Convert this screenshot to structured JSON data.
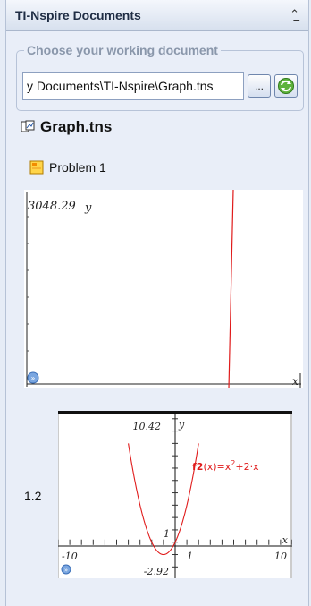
{
  "panel": {
    "title": "TI-Nspire Documents",
    "collapse_icon": "double-chevron-up-icon"
  },
  "chooser": {
    "legend": "Choose your working document",
    "path_value": "y Documents\\TI-Nspire\\Graph.tns",
    "browse_label": "...",
    "refresh_icon": "refresh-icon"
  },
  "document": {
    "name": "Graph.tns",
    "icon": "document-icon"
  },
  "problem": {
    "label": "Problem 1",
    "icon": "problem-icon"
  },
  "page1": {
    "y_top_label": "3048.29",
    "y_axis_label": "y",
    "x_axis_label": "x"
  },
  "page2": {
    "page_number": "1.2",
    "y_max_label": "10.42",
    "y_axis_label": "y",
    "y_min_label": "-2.92",
    "x_min_label": "-10",
    "x_max_label": "10",
    "x_axis_label": "x",
    "tick_one_x": "1",
    "tick_one_y": "1",
    "function_name": "f2",
    "function_arg": "(x)=x",
    "function_exp": "2",
    "function_tail": "+2·x",
    "function_color": "#e01b1b"
  }
}
